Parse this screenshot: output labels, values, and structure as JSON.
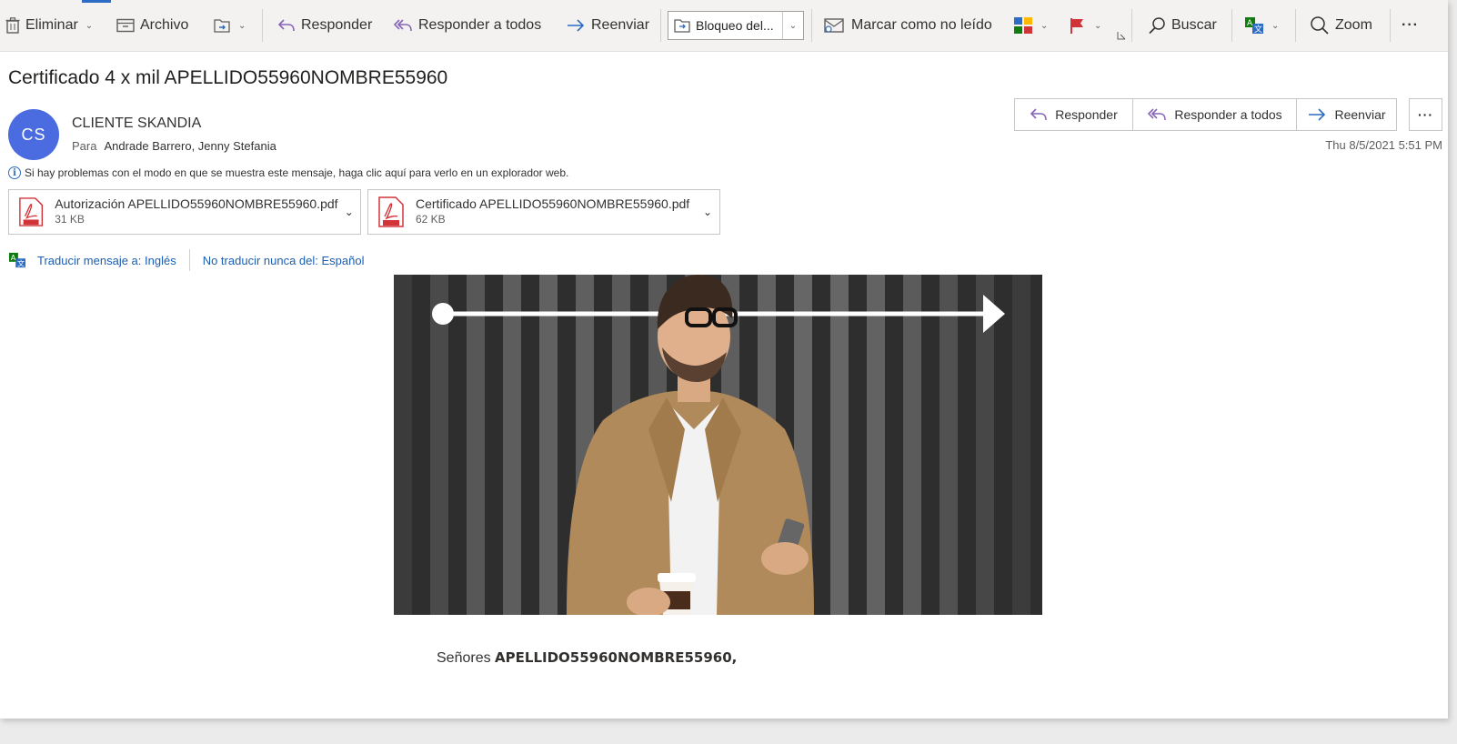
{
  "toolbar": {
    "delete_label": "Eliminar",
    "archive_label": "Archivo",
    "reply_label": "Responder",
    "reply_all_label": "Responder a todos",
    "forward_label": "Reenviar",
    "block_dropdown_value": "Bloqueo del...",
    "mark_unread_label": "Marcar como no leído",
    "search_label": "Buscar",
    "zoom_label": "Zoom",
    "more_label": "···"
  },
  "message": {
    "subject": "Certificado 4 x mil APELLIDO55960NOMBRE55960",
    "sender_initials": "CS",
    "sender_name": "CLIENTE SKANDIA",
    "to_label": "Para",
    "to_value": "Andrade Barrero, Jenny Stefania",
    "datetime": "Thu 8/5/2021 5:51 PM",
    "info_text": "Si hay problemas con el modo en que se muestra este mensaje, haga clic aquí para verlo en un explorador web."
  },
  "actions": {
    "reply_label": "Responder",
    "reply_all_label": "Responder a todos",
    "forward_label": "Reenviar",
    "more_label": "···"
  },
  "attachments": [
    {
      "name": "Autorización APELLIDO55960NOMBRE55960.pdf",
      "size": "31 KB"
    },
    {
      "name": "Certificado APELLIDO55960NOMBRE55960.pdf",
      "size": "62 KB"
    }
  ],
  "translate": {
    "translate_link": "Traducir mensaje a: Inglés",
    "never_translate_link": "No traducir nunca del: Español"
  },
  "body": {
    "greeting_prefix": "Señores ",
    "greeting_name": "APELLIDO55960NOMBRE55960,"
  },
  "colors": {
    "accent": "#2b6cc4",
    "avatar": "#4a6ce0",
    "pdf_red": "#d13438",
    "reply_purple": "#8764b8"
  }
}
